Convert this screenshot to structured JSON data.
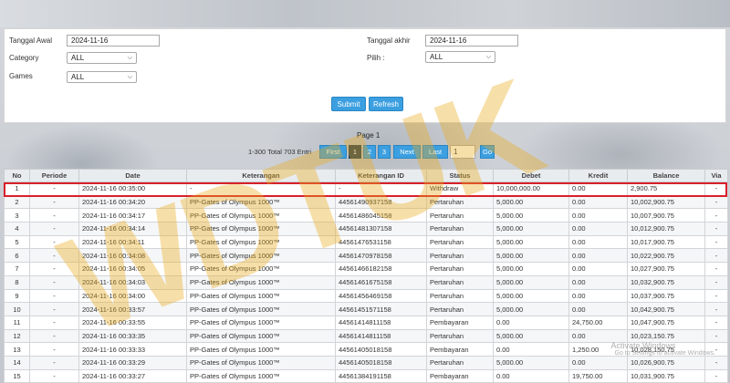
{
  "form": {
    "tanggal_awal_label": "Tanggal Awal",
    "tanggal_awal_value": "2024-11-16",
    "tanggal_akhir_label": "Tanggal akhir",
    "tanggal_akhir_value": "2024-11-16",
    "category_label": "Category",
    "category_value": "ALL",
    "pilih_label": "Pilih  :",
    "pilih_value": "ALL",
    "games_label": "Games",
    "games_value": "ALL",
    "submit_label": "Submit",
    "refresh_label": "Refresh"
  },
  "pager": {
    "title": "Page 1",
    "info": "1-300 Total 703 Entri",
    "first_label": "First",
    "pages": [
      "1",
      "2",
      "3"
    ],
    "next_label": "Next",
    "last_label": "Last",
    "page_input_value": "1",
    "go_label": "Go"
  },
  "table": {
    "headers": [
      "No",
      "Periode",
      "Date",
      "Keterangan",
      "Keterangan ID",
      "Status",
      "Debet",
      "Kredit",
      "Balance",
      "Via"
    ],
    "rows": [
      [
        "1",
        "-",
        "2024-11-16 00:35:00",
        "-",
        "-",
        "Withdraw",
        "10,000,000.00",
        "0.00",
        "2,900.75",
        "-"
      ],
      [
        "2",
        "-",
        "2024-11-16 00:34:20",
        "PP-Gates of Olympus 1000™",
        "44561490937158",
        "Pertaruhan",
        "5,000.00",
        "0.00",
        "10,002,900.75",
        "-"
      ],
      [
        "3",
        "-",
        "2024-11-16 00:34:17",
        "PP-Gates of Olympus 1000™",
        "44561486045158",
        "Pertaruhan",
        "5,000.00",
        "0.00",
        "10,007,900.75",
        "-"
      ],
      [
        "4",
        "-",
        "2024-11-16 00:34:14",
        "PP-Gates of Olympus 1000™",
        "44561481307158",
        "Pertaruhan",
        "5,000.00",
        "0.00",
        "10,012,900.75",
        "-"
      ],
      [
        "5",
        "-",
        "2024-11-16 00:34:11",
        "PP-Gates of Olympus 1000™",
        "44561476531158",
        "Pertaruhan",
        "5,000.00",
        "0.00",
        "10,017,900.75",
        "-"
      ],
      [
        "6",
        "-",
        "2024-11-16 00:34:08",
        "PP-Gates of Olympus 1000™",
        "44561470978158",
        "Pertaruhan",
        "5,000.00",
        "0.00",
        "10,022,900.75",
        "-"
      ],
      [
        "7",
        "-",
        "2024-11-16 00:34:05",
        "PP-Gates of Olympus 1000™",
        "44561466182158",
        "Pertaruhan",
        "5,000.00",
        "0.00",
        "10,027,900.75",
        "-"
      ],
      [
        "8",
        "-",
        "2024-11-16 00:34:03",
        "PP-Gates of Olympus 1000™",
        "44561461675158",
        "Pertaruhan",
        "5,000.00",
        "0.00",
        "10,032,900.75",
        "-"
      ],
      [
        "9",
        "-",
        "2024-11-16 00:34:00",
        "PP-Gates of Olympus 1000™",
        "44561456469158",
        "Pertaruhan",
        "5,000.00",
        "0.00",
        "10,037,900.75",
        "-"
      ],
      [
        "10",
        "-",
        "2024-11-16 00:33:57",
        "PP-Gates of Olympus 1000™",
        "44561451571158",
        "Pertaruhan",
        "5,000.00",
        "0.00",
        "10,042,900.75",
        "-"
      ],
      [
        "11",
        "-",
        "2024-11-16 00:33:55",
        "PP-Gates of Olympus 1000™",
        "44561414811158",
        "Pembayaran",
        "0.00",
        "24,750.00",
        "10,047,900.75",
        "-"
      ],
      [
        "12",
        "-",
        "2024-11-16 00:33:35",
        "PP-Gates of Olympus 1000™",
        "44561414811158",
        "Pertaruhan",
        "5,000.00",
        "0.00",
        "10,023,150.75",
        "-"
      ],
      [
        "13",
        "-",
        "2024-11-16 00:33:33",
        "PP-Gates of Olympus 1000™",
        "44561405018158",
        "Pembayaran",
        "0.00",
        "1,250.00",
        "10,028,150.75",
        "-"
      ],
      [
        "14",
        "-",
        "2024-11-16 00:33:29",
        "PP-Gates of Olympus 1000™",
        "44561405018158",
        "Pertaruhan",
        "5,000.00",
        "0.00",
        "10,026,900.75",
        "-"
      ],
      [
        "15",
        "-",
        "2024-11-16 00:33:27",
        "PP-Gates of Olympus 1000™",
        "44561384191158",
        "Pembayaran",
        "0.00",
        "19,750.00",
        "10,031,900.75",
        "-"
      ]
    ]
  },
  "overlay": {
    "watermark_text": "WDTUK",
    "activate_title": "Activate Windows",
    "activate_sub": "Go to Settings to activate Windows."
  },
  "colors": {
    "accent": "#3b9fe0",
    "active_page": "#1f3b55",
    "highlight": "#d8202a",
    "link": "#3a7fc1",
    "watermark": "#ebaa1e"
  }
}
